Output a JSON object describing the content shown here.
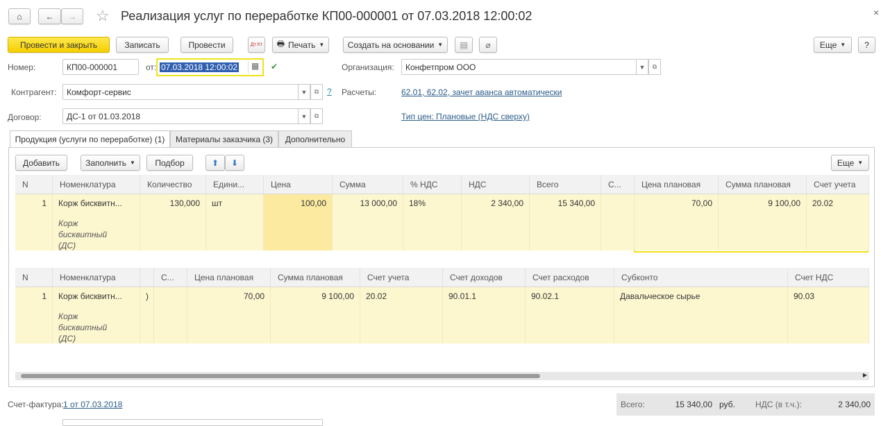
{
  "window": {
    "title": "Реализация услуг по переработке КП00-000001 от 07.03.2018 12:00:02"
  },
  "toolbar": {
    "post_close": "Провести и закрыть",
    "save": "Записать",
    "post": "Провести",
    "dtkt": "Дт Кт",
    "print": "Печать",
    "create_based": "Создать на основании",
    "more": "Еще",
    "help": "?"
  },
  "form": {
    "number_label": "Номер:",
    "number": "КП00-000001",
    "date_label": "от:",
    "date": "07.03.2018 12:00:02",
    "org_label": "Организация:",
    "org": "Конфетпром ООО",
    "counterparty_label": "Контрагент:",
    "counterparty": "Комфорт-сервис",
    "help": "?",
    "settlements_label": "Расчеты:",
    "settlements_link": "62.01, 62.02, зачет аванса автоматически",
    "contract_label": "Договор:",
    "contract": "ДС-1 от 01.03.2018",
    "price_type_link": "Тип цен: Плановые (НДС сверху)"
  },
  "tabs": [
    {
      "label": "Продукция (услуги по переработке) (1)"
    },
    {
      "label": "Материалы заказчика (3)"
    },
    {
      "label": "Дополнительно"
    }
  ],
  "table_toolbar": {
    "add": "Добавить",
    "fill": "Заполнить",
    "select": "Подбор",
    "more": "Еще"
  },
  "table1": {
    "headers": [
      "N",
      "Номенклатура",
      "Количество",
      "Едини...",
      "Цена",
      "Сумма",
      "% НДС",
      "НДС",
      "Всего",
      "С...",
      "Цена плановая",
      "Сумма плановая",
      "Счет учета"
    ],
    "row": {
      "n": "1",
      "item": "Корж бисквитн...",
      "item_desc": "Корж бисквитный (ДС)",
      "qty": "130,000",
      "unit": "шт",
      "price": "100,00",
      "sum": "13 000,00",
      "vat_rate": "18%",
      "vat": "2 340,00",
      "total": "15 340,00",
      "plan_price": "70,00",
      "plan_sum": "9 100,00",
      "account": "20.02"
    }
  },
  "table2": {
    "headers": [
      "N",
      "Номенклатура",
      "С...",
      "Цена плановая",
      "Сумма плановая",
      "Счет учета",
      "Счет доходов",
      "Счет расходов",
      "Субконто",
      "Счет НДС"
    ],
    "row": {
      "n": "1",
      "item": "Корж бисквитн...",
      "paren": ")",
      "item_desc": "Корж бисквитный (ДС)",
      "plan_price": "70,00",
      "plan_sum": "9 100,00",
      "account": "20.02",
      "income": "90.01.1",
      "expense": "90.02.1",
      "subconto": "Давальческое сырье",
      "vat_account": "90.03"
    }
  },
  "footer": {
    "invoice_label": "Счет-фактура:",
    "invoice_link": "1 от 07.03.2018",
    "total_label": "Всего:",
    "total": "15 340,00",
    "currency": "руб.",
    "vat_label": "НДС (в т.ч.):",
    "vat": "2 340,00"
  },
  "colors": {
    "primary": "#f5cf00",
    "highlight_orange": "#e07b2a",
    "highlight_yellow": "#f0e21a",
    "row_bg": "#fdf7d0"
  }
}
